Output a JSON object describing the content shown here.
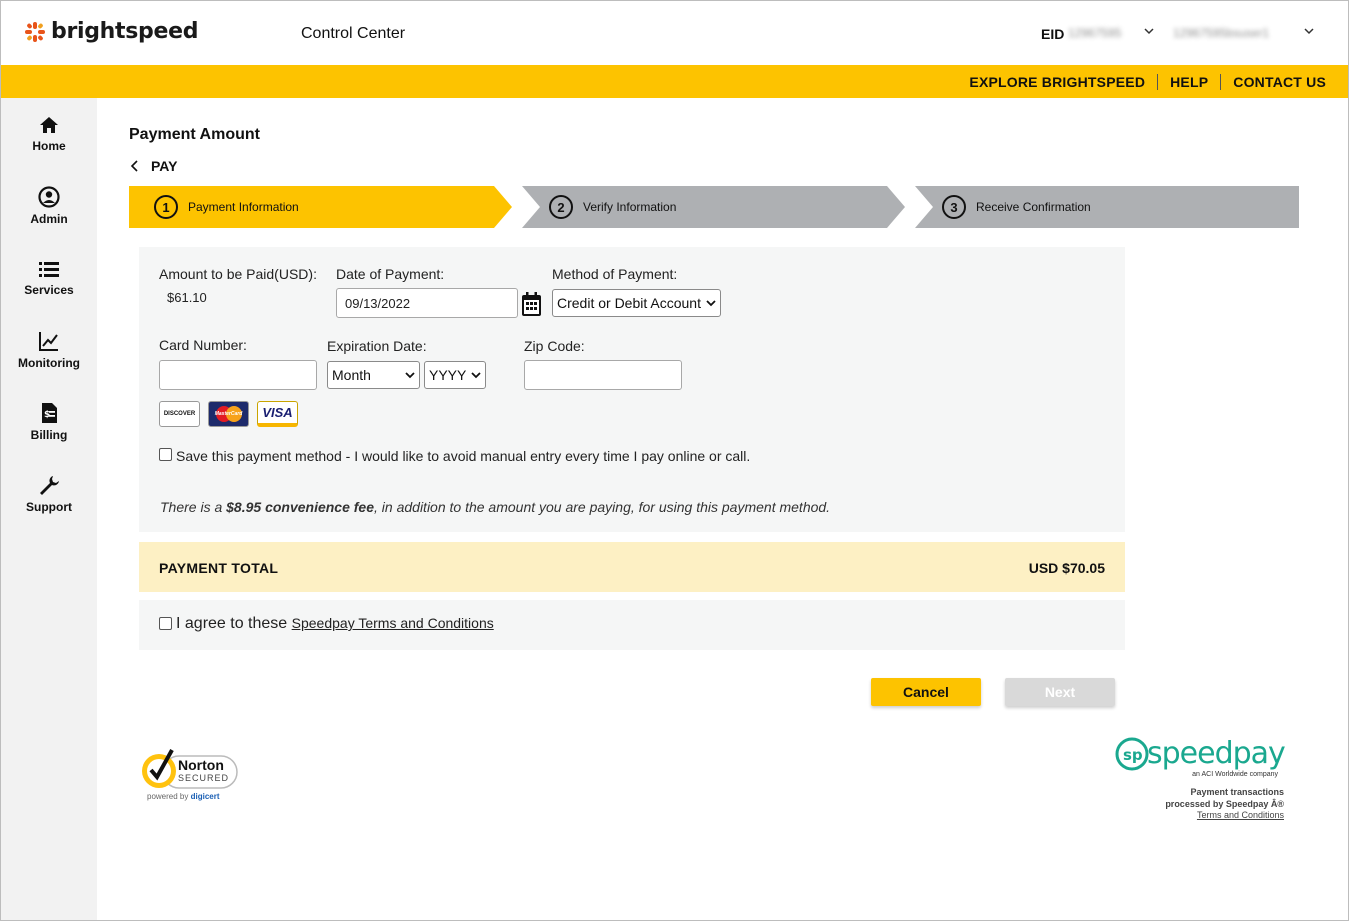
{
  "header": {
    "brand": "brightspeed",
    "app_title": "Control Center",
    "eid_label": "EID",
    "eid_value": "12967595",
    "user_value": "12967595bsuser1"
  },
  "topnav": [
    {
      "label": "EXPLORE BRIGHTSPEED"
    },
    {
      "label": "HELP"
    },
    {
      "label": "CONTACT US"
    }
  ],
  "sidebar": {
    "items": [
      {
        "label": "Home",
        "icon": "home-icon"
      },
      {
        "label": "Admin",
        "icon": "user-icon"
      },
      {
        "label": "Services",
        "icon": "list-icon"
      },
      {
        "label": "Monitoring",
        "icon": "chart-icon"
      },
      {
        "label": "Billing",
        "icon": "bill-icon"
      },
      {
        "label": "Support",
        "icon": "wrench-icon"
      }
    ]
  },
  "main": {
    "page_title": "Payment Amount",
    "back_label": "PAY",
    "steps": [
      {
        "num": "1",
        "label": "Payment Information",
        "active": true
      },
      {
        "num": "2",
        "label": "Verify Information",
        "active": false
      },
      {
        "num": "3",
        "label": "Receive Confirmation",
        "active": false
      }
    ],
    "form": {
      "amount_label": "Amount to be Paid(USD):",
      "amount_value": "$61.10",
      "date_label": "Date of Payment:",
      "date_value": "09/13/2022",
      "method_label": "Method of Payment:",
      "method_value": "Credit or Debit Account",
      "card_label": "Card Number:",
      "card_value": "",
      "exp_label": "Expiration Date:",
      "exp_month": "Month",
      "exp_year": "YYYY",
      "zip_label": "Zip Code:",
      "zip_value": "",
      "cards": [
        "DISCOVER",
        "MasterCard",
        "VISA"
      ],
      "save_text": "Save this payment method - I would like to avoid manual entry every time I pay online or call.",
      "fee_prefix": "There is a ",
      "fee_bold": "$8.95 convenience fee",
      "fee_suffix": ", in addition to the amount you are paying, for using this payment method."
    },
    "total": {
      "label": "PAYMENT TOTAL",
      "value": "USD $70.05"
    },
    "terms": {
      "prefix": "I agree to these ",
      "link": "Speedpay Terms and Conditions"
    },
    "buttons": {
      "cancel": "Cancel",
      "next": "Next"
    }
  },
  "footer": {
    "norton_name": "Norton",
    "norton_sub": "SECURED",
    "norton_powered": "powered by",
    "norton_digicert": "digicert",
    "speedpay_name": "speedpay",
    "speedpay_tag": "an ACI Worldwide company",
    "speedpay_line1": "Payment transactions",
    "speedpay_line2": "processed by Speedpay Â®",
    "speedpay_terms": "Terms and Conditions"
  },
  "colors": {
    "brand_yellow": "#fdc300",
    "step_gray": "#aeb0b3",
    "total_bg": "#fdf0c4",
    "speedpay_teal": "#1aa88f",
    "brand_orange": "#e8541a"
  }
}
